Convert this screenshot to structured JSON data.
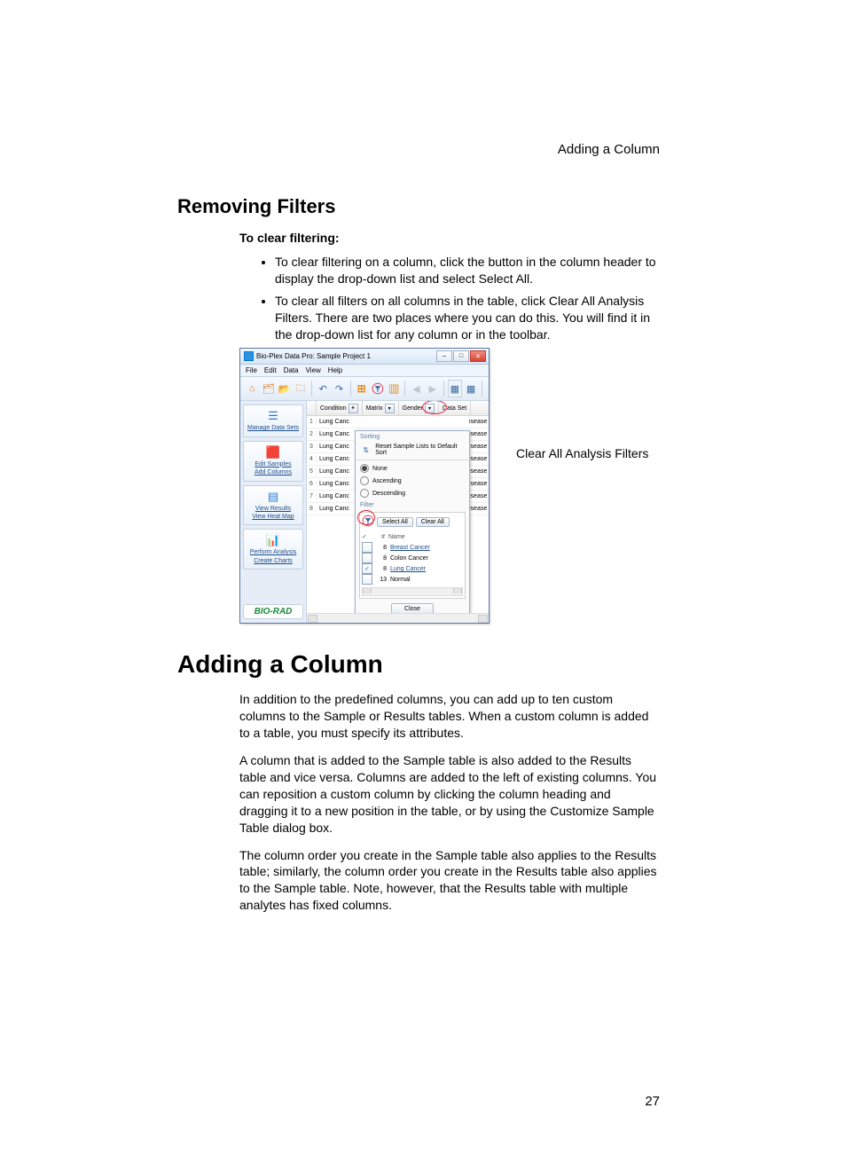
{
  "runningHead": "Adding a Column",
  "section1": {
    "title": "Removing Filters",
    "subhead": "To clear filtering:",
    "bullets": [
      "To clear filtering on a column, click the button in the column header to display the drop-down list and select Select All.",
      "To clear all filters on all columns in the table, click Clear All Analysis Filters. There are two places where you can do this. You will find it in the drop-down list for any column or in the toolbar."
    ]
  },
  "calloutLabel": "Clear All Analysis Filters",
  "screenshot": {
    "title": "Bio-Plex Data Pro: Sample Project 1",
    "menus": [
      "File",
      "Edit",
      "Data",
      "View",
      "Help"
    ],
    "sidebar": {
      "manage": "Manage Data Sets",
      "edit": "Edit Samples",
      "addCols": "Add Columns",
      "viewResults": "View Results",
      "viewHeat": "View Heat Map",
      "perform": "Perform Analysis",
      "charts": "Create Charts",
      "logo": "BIO-RAD"
    },
    "headers": [
      "Condition",
      "Matrix",
      "Gender",
      "Data Set"
    ],
    "rows": [
      {
        "n": "1",
        "c1": "Lung Canc",
        "c2": "isease"
      },
      {
        "n": "2",
        "c1": "Lung Canc",
        "c2": "isease"
      },
      {
        "n": "3",
        "c1": "Lung Canc",
        "c2": "isease"
      },
      {
        "n": "4",
        "c1": "Lung Canc",
        "c2": "isease"
      },
      {
        "n": "5",
        "c1": "Lung Canc",
        "c2": "isease"
      },
      {
        "n": "6",
        "c1": "Lung Canc",
        "c2": "isease"
      },
      {
        "n": "7",
        "c1": "Lung Canc",
        "c2": "isease"
      },
      {
        "n": "8",
        "c1": "Lung Canc",
        "c2": "isease"
      }
    ],
    "popup": {
      "sorting": "Sorting",
      "reset": "Reset Sample Lists to Default Sort",
      "none": "None",
      "asc": "Ascending",
      "desc": "Descending",
      "filter": "Filter",
      "selectAll": "Select All",
      "clearAll": "Clear All",
      "colNum": "#",
      "colName": "Name",
      "entries": [
        {
          "checked": false,
          "num": "8",
          "name": "Breast Cancer",
          "link": true
        },
        {
          "checked": false,
          "num": "8",
          "name": "Colon Cancer",
          "link": false
        },
        {
          "checked": true,
          "num": "8",
          "name": "Lung Cancer",
          "link": true
        },
        {
          "checked": false,
          "num": "13",
          "name": "Normal",
          "link": false
        }
      ],
      "close": "Close"
    }
  },
  "section2": {
    "title": "Adding a Column",
    "p1": "In addition to the predefined columns, you can add up to ten custom columns to the Sample or Results tables. When a custom column is added to a table, you must specify its attributes.",
    "p2": "A column that is added to the Sample table is also added to the Results table and vice versa. Columns are added to the left of existing columns. You can reposition a custom column by clicking the column heading and dragging it to a new position in the table, or by using the Customize Sample Table dialog box.",
    "p3": "The column order you create in the Sample table also applies to the Results table; similarly, the column order you create in the Results table also applies to the Sample table. Note, however, that the Results table with multiple analytes has fixed columns."
  },
  "pageNumber": "27"
}
